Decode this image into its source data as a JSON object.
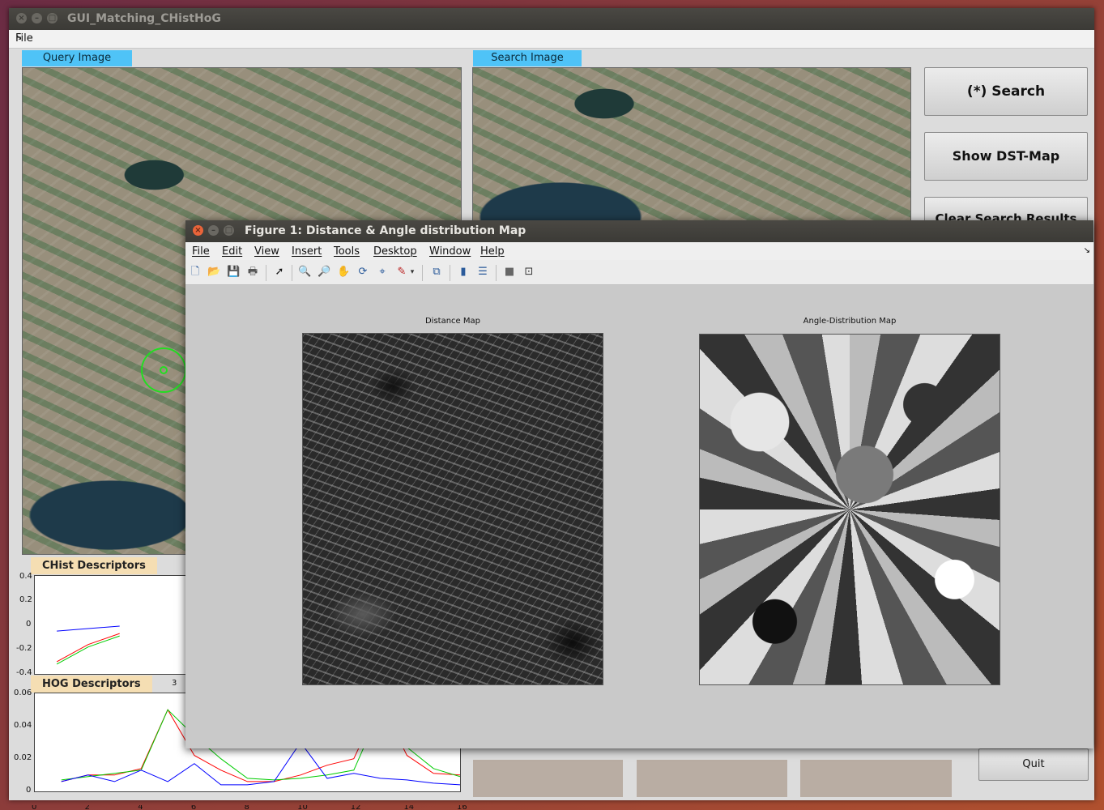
{
  "main_window": {
    "title": "GUI_Matching_CHistHoG",
    "menu_file": "File",
    "query_label": "Query Image",
    "search_label": "Search Image",
    "buttons": {
      "search": "(*) Search",
      "show_dst": "Show DST-Map",
      "clear": "Clear Search Results",
      "quit": "Quit"
    },
    "chist_label": "CHist Descriptors",
    "hog_label": "HOG Descriptors",
    "chist_axis": {
      "yticks": [
        "0.4",
        "0.2",
        "0",
        "-0.2",
        "-0.4"
      ],
      "xticks": [
        "3"
      ]
    },
    "hog_axis": {
      "yticks": [
        "0.06",
        "0.04",
        "0.02",
        "0"
      ],
      "xticks": [
        "0",
        "2",
        "4",
        "6",
        "8",
        "10",
        "12",
        "14",
        "16"
      ]
    }
  },
  "figure": {
    "title": "Figure 1: Distance & Angle distribution Map",
    "menu": [
      "File",
      "Edit",
      "View",
      "Insert",
      "Tools",
      "Desktop",
      "Window",
      "Help"
    ],
    "distance_title": "Distance Map",
    "angle_title": "Angle-Distribution Map"
  },
  "chart_data": [
    {
      "type": "line",
      "title": "CHist Descriptors",
      "ylim": [
        -0.4,
        0.4
      ],
      "series": [
        {
          "color": "#0000ff",
          "x": [
            1,
            2,
            3
          ],
          "values": [
            -0.05,
            -0.03,
            -0.01
          ]
        },
        {
          "color": "#ff0000",
          "x": [
            1,
            2,
            3
          ],
          "values": [
            -0.3,
            -0.16,
            -0.07
          ]
        },
        {
          "color": "#00cc00",
          "x": [
            1,
            2,
            3
          ],
          "values": [
            -0.32,
            -0.18,
            -0.09
          ]
        }
      ]
    },
    {
      "type": "line",
      "title": "HOG Descriptors",
      "xlim": [
        0,
        16
      ],
      "ylim": [
        0,
        0.06
      ],
      "series": [
        {
          "color": "#ff0000",
          "x": [
            1,
            2,
            3,
            4,
            5,
            6,
            7,
            8,
            9,
            10,
            11,
            12,
            13,
            14,
            15,
            16
          ],
          "values": [
            0.006,
            0.01,
            0.01,
            0.014,
            0.05,
            0.022,
            0.013,
            0.006,
            0.006,
            0.01,
            0.016,
            0.02,
            0.055,
            0.022,
            0.011,
            0.01
          ]
        },
        {
          "color": "#00cc00",
          "x": [
            1,
            2,
            3,
            4,
            5,
            6,
            7,
            8,
            9,
            10,
            11,
            12,
            13,
            14,
            15,
            16
          ],
          "values": [
            0.007,
            0.009,
            0.011,
            0.013,
            0.05,
            0.034,
            0.02,
            0.008,
            0.007,
            0.008,
            0.01,
            0.013,
            0.05,
            0.027,
            0.014,
            0.009
          ]
        },
        {
          "color": "#0000ff",
          "x": [
            1,
            2,
            3,
            4,
            5,
            6,
            7,
            8,
            9,
            10,
            11,
            12,
            13,
            14,
            15,
            16
          ],
          "values": [
            0.006,
            0.01,
            0.006,
            0.013,
            0.006,
            0.017,
            0.004,
            0.004,
            0.006,
            0.03,
            0.008,
            0.011,
            0.008,
            0.007,
            0.005,
            0.004
          ]
        }
      ]
    }
  ]
}
